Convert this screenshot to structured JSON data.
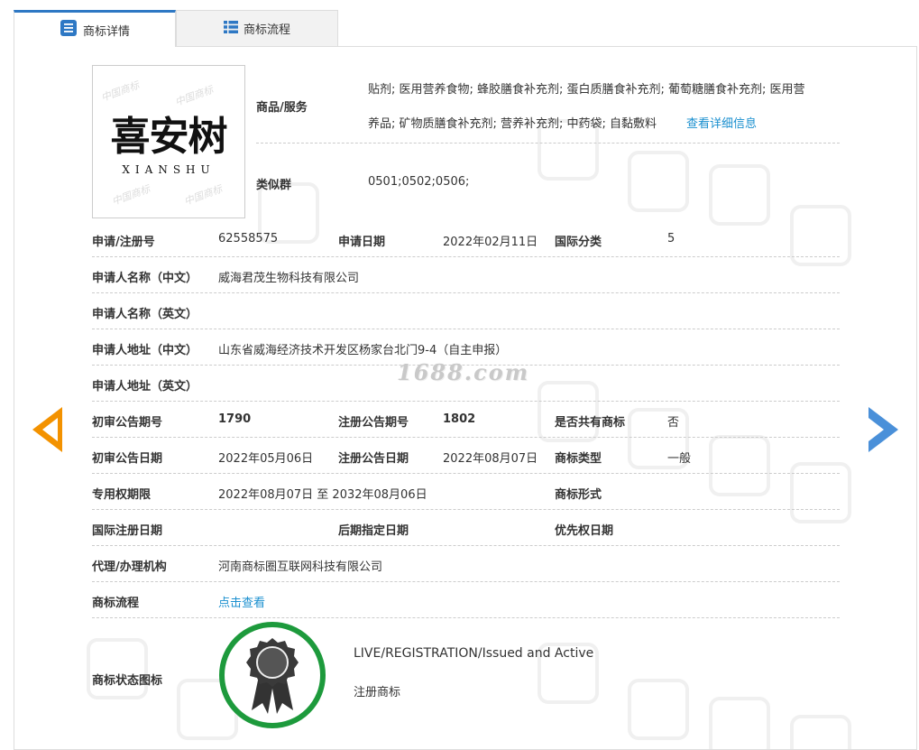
{
  "tabs": {
    "detail_label": "商标详情",
    "flow_label": "商标流程"
  },
  "logo": {
    "text": "喜安树",
    "subtext": "XIANSHU",
    "watermark": "中国商标"
  },
  "goods": {
    "label": "商品/服务",
    "line1": "贴剂; 医用营养食物; 蜂胶膳食补充剂; 蛋白质膳食补充剂; 葡萄糖膳食补充剂; 医用营",
    "line2": "养品; 矿物质膳食补充剂; 营养补充剂; 中药袋; 自黏敷料",
    "more_link": "查看详细信息"
  },
  "similar_group": {
    "label": "类似群",
    "value": "0501;0502;0506;"
  },
  "info": {
    "reg_no_label": "申请/注册号",
    "reg_no": "62558575",
    "apply_date_label": "申请日期",
    "apply_date": "2022年02月11日",
    "intl_class_label": "国际分类",
    "intl_class": "5",
    "applicant_cn_label": "申请人名称（中文）",
    "applicant_cn": "威海君茂生物科技有限公司",
    "applicant_en_label": "申请人名称（英文）",
    "applicant_en": "",
    "address_cn_label": "申请人地址（中文）",
    "address_cn": "山东省威海经济技术开发区杨家台北门9-4（自主申报）",
    "address_en_label": "申请人地址（英文）",
    "address_en": "",
    "prelim_no_label": "初审公告期号",
    "prelim_no": "1790",
    "reg_pub_no_label": "注册公告期号",
    "reg_pub_no": "1802",
    "shared_label": "是否共有商标",
    "shared": "否",
    "prelim_date_label": "初审公告日期",
    "prelim_date": "2022年05月06日",
    "reg_pub_date_label": "注册公告日期",
    "reg_pub_date": "2022年08月07日",
    "type_label": "商标类型",
    "type": "一般",
    "exclusive_label": "专用权期限",
    "exclusive": "2022年08月07日 至 2032年08月06日",
    "form_label": "商标形式",
    "form": "",
    "intl_reg_date_label": "国际注册日期",
    "intl_reg_date": "",
    "later_date_label": "后期指定日期",
    "later_date": "",
    "priority_label": "优先权日期",
    "priority": "",
    "agent_label": "代理/办理机构",
    "agent": "河南商标圈互联网科技有限公司",
    "flow_label": "商标流程",
    "flow_link": "点击查看",
    "status_label": "商标状态图标",
    "status_en": "LIVE/REGISTRATION/Issued and Active",
    "status_cn": "注册商标"
  },
  "overlay": {
    "site_watermark": "1688.com"
  },
  "colors": {
    "accent_blue": "#2e78c4",
    "link": "#1a8fcf",
    "prev_arrow": "#f39200",
    "next_arrow": "#4a90d9",
    "status_green": "#1d9a3c"
  }
}
